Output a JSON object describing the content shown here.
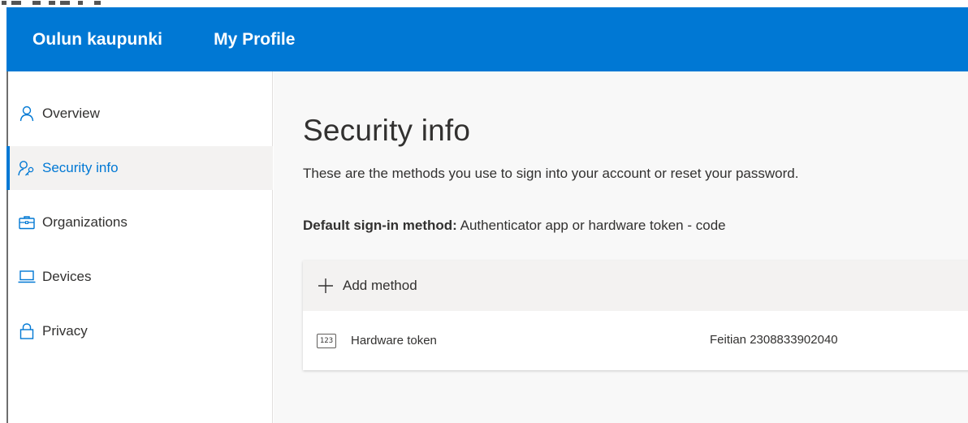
{
  "header": {
    "brand": "Oulun kaupunki",
    "app_name": "My Profile",
    "accent_color": "#0078d4"
  },
  "sidebar": {
    "items": [
      {
        "label": "Overview",
        "icon": "person-icon",
        "active": false
      },
      {
        "label": "Security info",
        "icon": "security-person-key-icon",
        "active": true
      },
      {
        "label": "Organizations",
        "icon": "briefcase-icon",
        "active": false
      },
      {
        "label": "Devices",
        "icon": "laptop-icon",
        "active": false
      },
      {
        "label": "Privacy",
        "icon": "lock-icon",
        "active": false
      }
    ]
  },
  "main": {
    "title": "Security info",
    "subtitle": "These are the methods you use to sign into your account or reset your password.",
    "default_method_label": "Default sign-in method:",
    "default_method_value": "Authenticator app or hardware token - code",
    "add_method_label": "Add method",
    "methods": [
      {
        "icon_text": "123",
        "icon": "hardware-token-icon",
        "name": "Hardware token",
        "detail": "Feitian 2308833902040"
      }
    ]
  }
}
